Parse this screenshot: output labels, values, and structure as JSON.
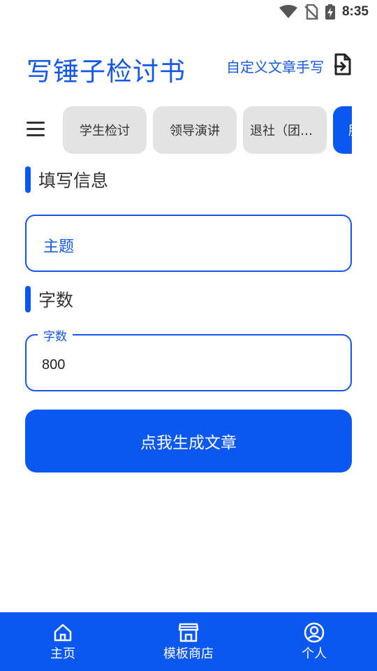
{
  "status_bar": {
    "time": "8:35",
    "icons": [
      "wifi-icon",
      "no-sim-icon",
      "battery-charging-icon"
    ]
  },
  "header": {
    "title": "写锤子检讨书",
    "custom_link_label": "自定义文章手写",
    "custom_link_icon": "document-import-icon"
  },
  "categories": {
    "menu_icon": "hamburger-menu-icon",
    "tabs": [
      {
        "label": "学生检讨",
        "active": false
      },
      {
        "label": "领导演讲",
        "active": false
      },
      {
        "label": "退社（团…",
        "active": false
      },
      {
        "label": "服",
        "active": true
      }
    ]
  },
  "form": {
    "section_info_title": "填写信息",
    "topic_placeholder": "主题",
    "section_words_title": "字数",
    "words_field_label": "字数",
    "words_value": "800"
  },
  "generate_button_label": "点我生成文章",
  "bottom_nav": {
    "items": [
      {
        "label": "主页",
        "icon": "home-icon"
      },
      {
        "label": "模板商店",
        "icon": "store-icon"
      },
      {
        "label": "个人",
        "icon": "user-icon"
      }
    ]
  },
  "colors": {
    "accent": "#0b57f2",
    "title_blue": "#1558e6",
    "chip_bg": "#e3e3e3"
  }
}
